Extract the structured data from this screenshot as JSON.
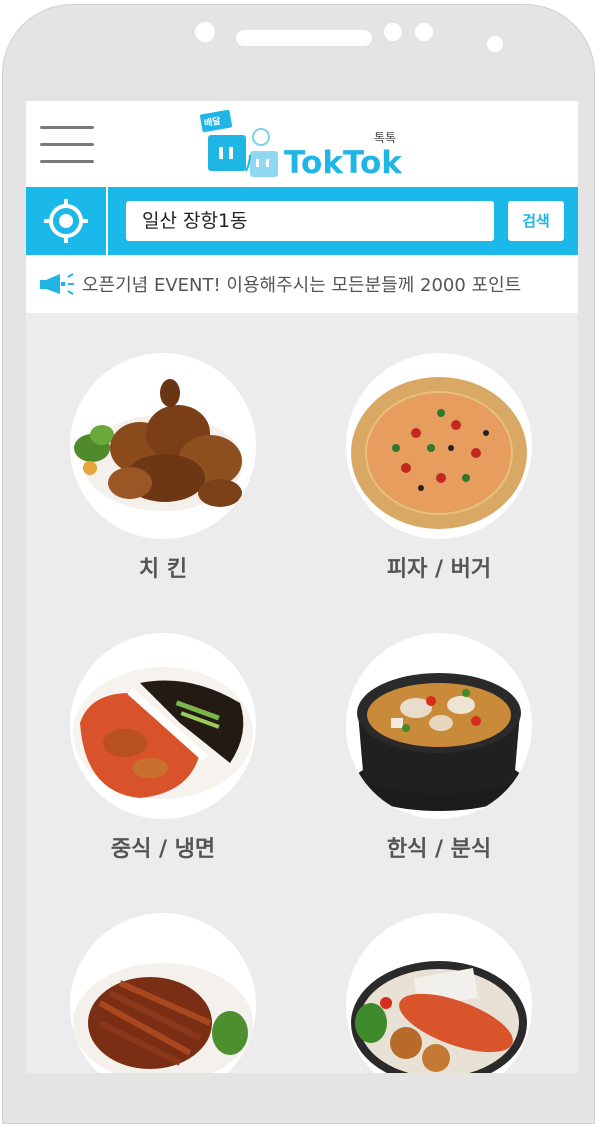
{
  "app": {
    "logo_text": "TokTok",
    "logo_sub": "톡톡",
    "logo_badge": "배달"
  },
  "search": {
    "location_value": "일산 장항1동",
    "button_label": "검색"
  },
  "notice": {
    "text": "오픈기념 EVENT! 이용해주시는 모든분들께 2000  포인트"
  },
  "categories": [
    {
      "label": "치 킨"
    },
    {
      "label": "피자 / 버거"
    },
    {
      "label": "중식 / 냉면"
    },
    {
      "label": "한식 / 분식"
    }
  ],
  "colors": {
    "accent": "#1ab9ea",
    "background": "#ececec",
    "label": "#555555"
  },
  "icons": [
    "menu-icon",
    "locate-icon",
    "megaphone-icon"
  ]
}
